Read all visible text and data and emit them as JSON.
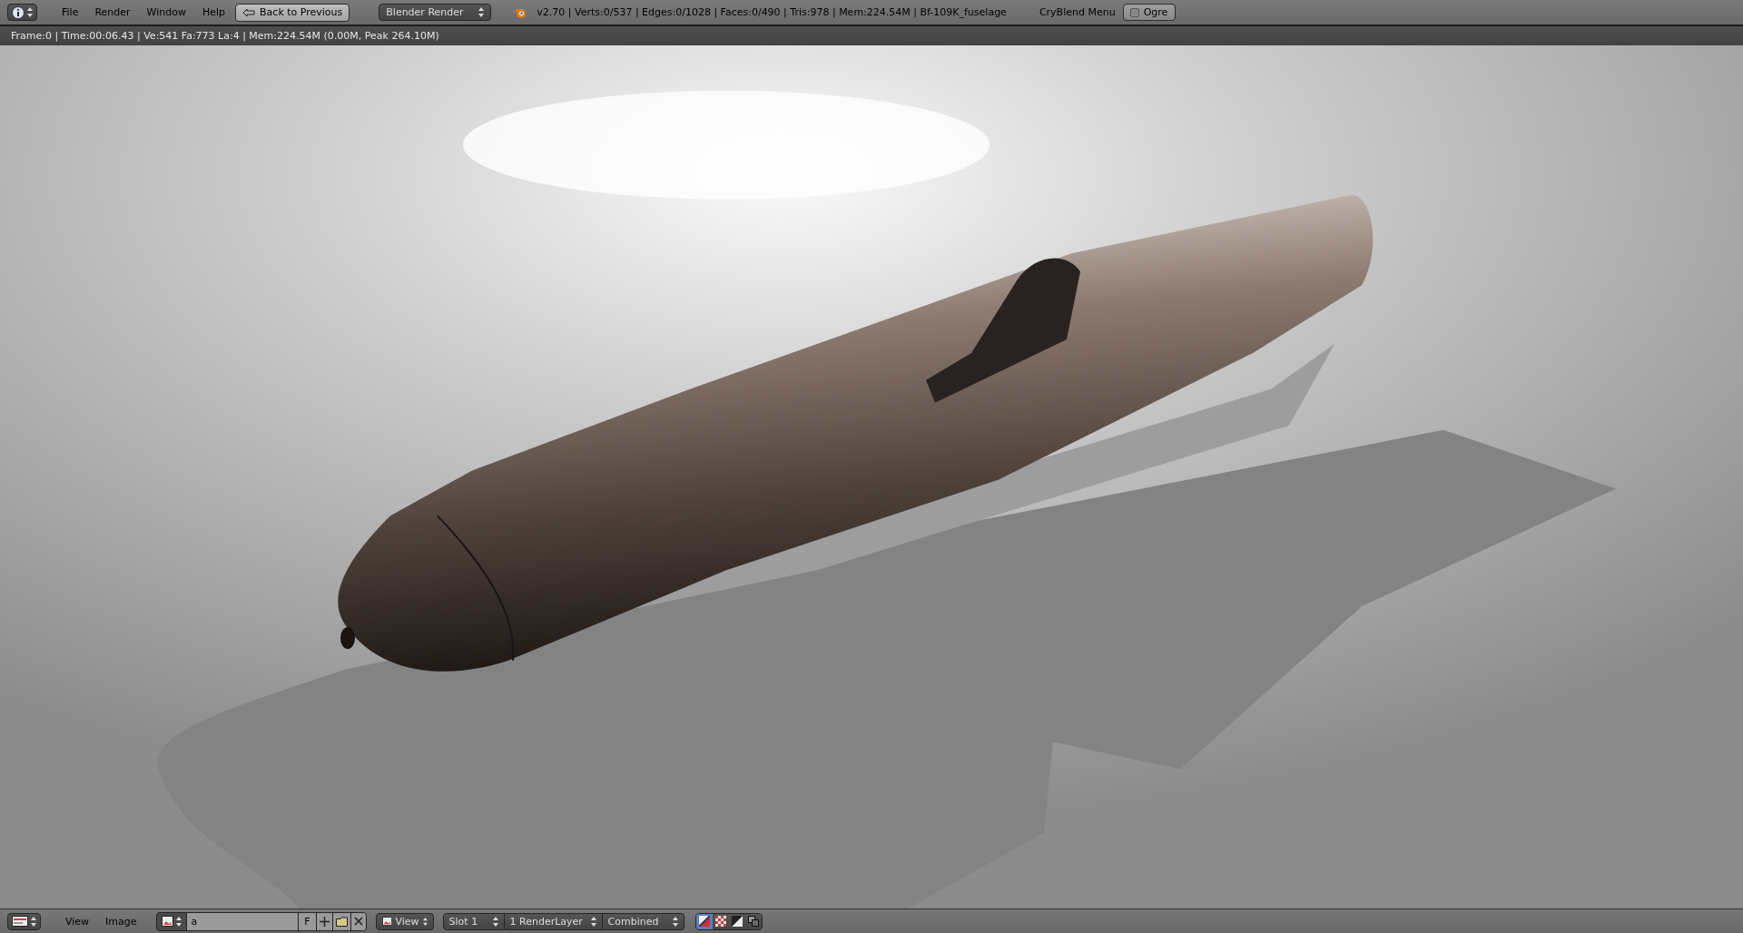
{
  "top_bar": {
    "menus": [
      "File",
      "Render",
      "Window",
      "Help"
    ],
    "back_button": "Back to Previous",
    "render_engine": "Blender Render",
    "stats": "v2.70 | Verts:0/537 | Edges:0/1028 | Faces:0/490 | Tris:978 | Mem:224.54M | Bf-109K_fuselage",
    "addon_label": "CryBlend Menu",
    "ogre_toggle": {
      "label": "Ogre",
      "checked": false
    }
  },
  "render_info": "Frame:0 | Time:00:06.43 | Ve:541 Fa:773 La:4 | Mem:224.54M (0.00M, Peak 264.10M)",
  "bottom_bar": {
    "menus": [
      "View",
      "Image"
    ],
    "image_name": "a",
    "fake_user": "F",
    "view_select": "View",
    "slot": "Slot 1",
    "render_layer": "1 RenderLayer",
    "pass": "Combined",
    "display_modes": [
      {
        "kind": "color-alpha",
        "selected": true
      },
      {
        "kind": "alpha",
        "selected": false
      },
      {
        "kind": "z-buffer",
        "selected": false
      },
      {
        "kind": "overlay",
        "selected": false
      }
    ]
  }
}
